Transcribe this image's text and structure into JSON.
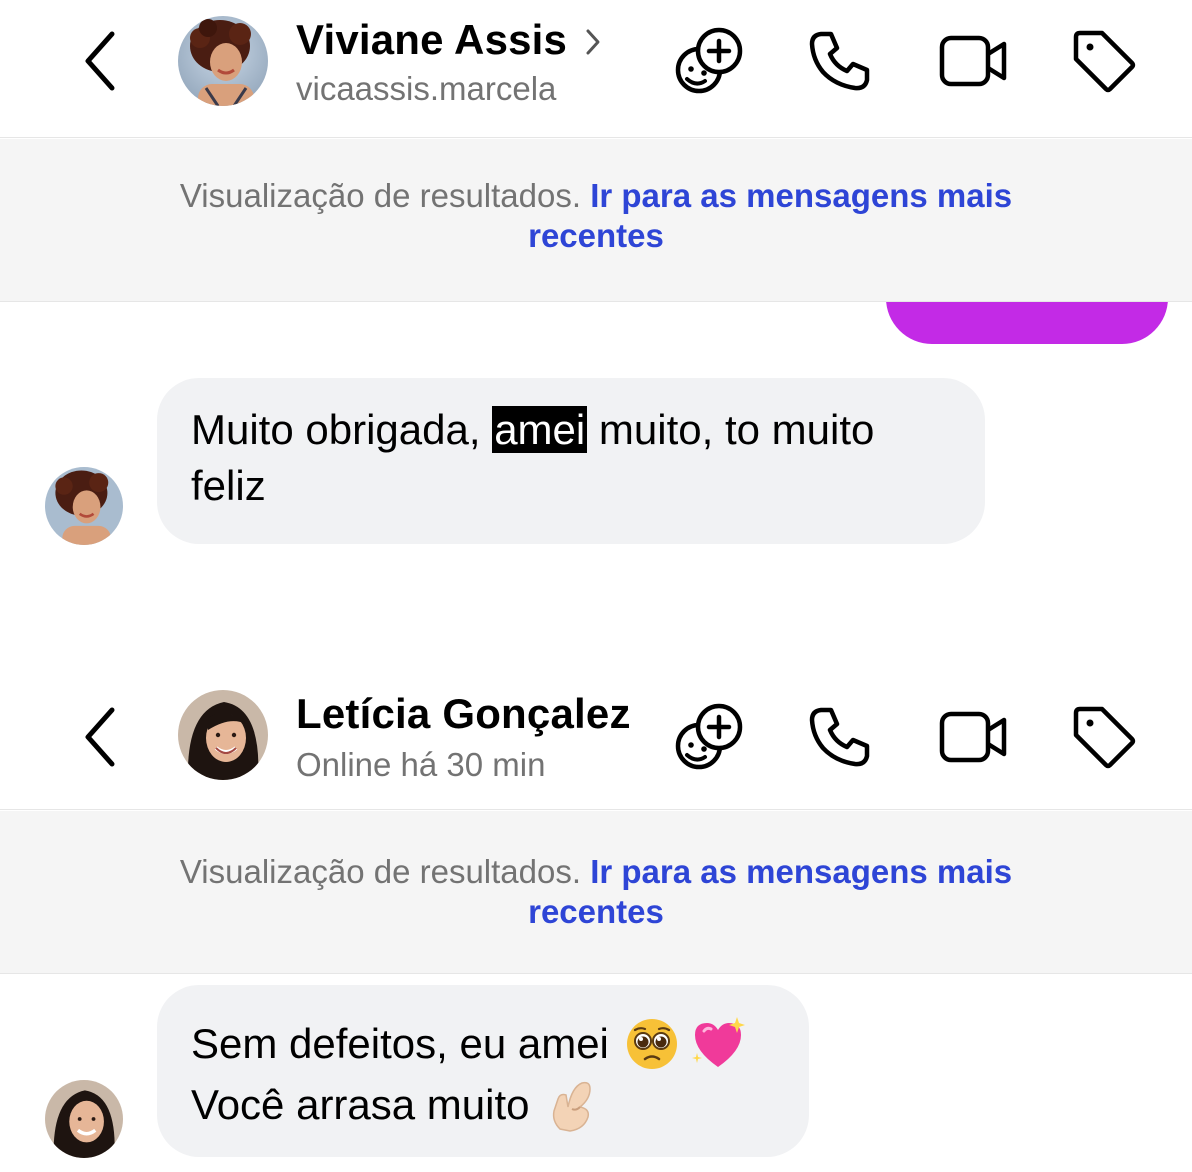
{
  "conversations": [
    {
      "contact_name": "Viviane Assis",
      "subtitle": "vicaassis.marcela",
      "banner": {
        "text": "Visualização de resultados.",
        "link_line1": "Ir para as mensagens mais",
        "link_line2": "recentes"
      },
      "message": {
        "part_before": "Muito obrigada, ",
        "highlight": "amei",
        "part_after": " muito, to muito",
        "line2": "feliz"
      }
    },
    {
      "contact_name": "Letícia Gonçalez",
      "subtitle": "Online há 30 min",
      "banner": {
        "text": "Visualização de resultados.",
        "link_line1": "Ir para as mensagens mais",
        "link_line2": "recentes"
      },
      "message": {
        "line1": "Sem defeitos, eu amei",
        "line2": "Você arrasa muito"
      }
    }
  ],
  "icons": {
    "back": "chevron-left-icon",
    "effects": "sticker-add-icon",
    "call": "phone-icon",
    "video": "video-camera-icon",
    "tag": "tag-icon",
    "emoji_1": "pleading-face-emoji",
    "emoji_2": "sparkling-heart-emoji",
    "emoji_3": "pinching-hand-emoji"
  },
  "colors": {
    "link": "#2e45d6",
    "outgoing_bubble": "#c32ae6",
    "incoming_bubble": "#f1f2f4",
    "banner_bg": "#f5f5f5",
    "muted_text": "#737373"
  }
}
